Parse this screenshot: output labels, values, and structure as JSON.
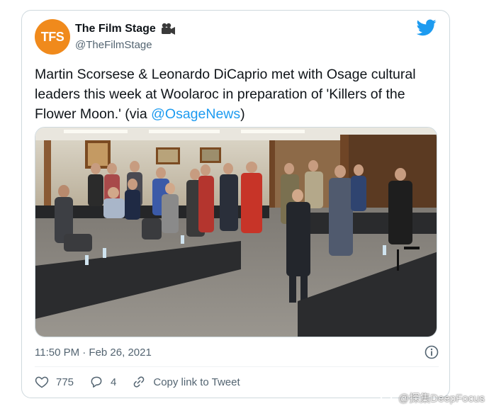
{
  "tweet": {
    "avatar_text": "TFS",
    "display_name": "The Film Stage",
    "handle": "@TheFilmStage",
    "text_before": "Martin Scorsese & Leonardo DiCaprio met with Osage cultural leaders this week at Woolaroc in preparation of 'Killers of the Flower Moon.' (via ",
    "mention": "@OsageNews",
    "text_after": ")",
    "timestamp": "11:50 PM · Feb 26, 2021",
    "likes": "775",
    "replies": "4",
    "copy_link_label": "Copy link to Tweet"
  },
  "icons": {
    "emoji": "movie-camera-icon",
    "brand": "twitter-bird-icon",
    "info": "info-icon",
    "like": "heart-icon",
    "reply": "reply-bubble-icon",
    "link": "link-icon"
  },
  "colors": {
    "accent": "#1d9bf0",
    "text": "#0f1419",
    "muted": "#536471",
    "avatar": "#f08a1c"
  },
  "watermark": {
    "text": "@探集DeepFocus"
  }
}
